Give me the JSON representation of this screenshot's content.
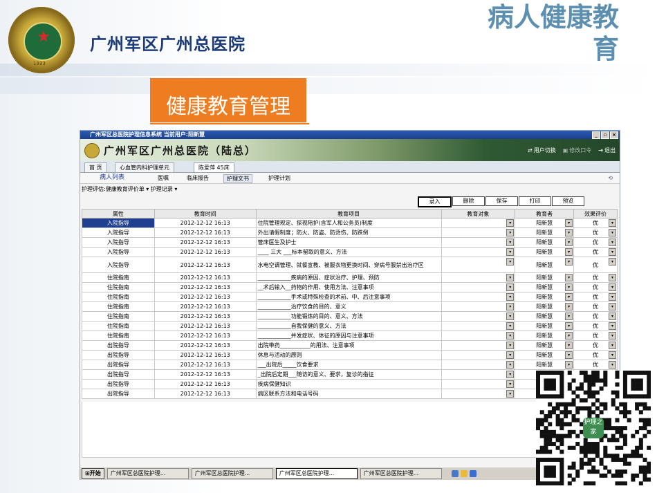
{
  "slide": {
    "hospital_name": "广州军区广州总医院",
    "title": "病人健康教育",
    "section": "健康教育管理",
    "logo_year": "1933",
    "logo_text": "General Hospital of Guangzhou Military Command"
  },
  "window": {
    "title": "广州军区总医院护理信息系统  当前用户:阳新慧",
    "banner_title": "广州军区广州总医院（陆总）",
    "actions": [
      "用户切换",
      "修改口令",
      "退出"
    ],
    "tabs": [
      "首  页",
      "心血管内科护理单元",
      "陈爱萍 45床"
    ],
    "subtabs": [
      "病人列表",
      "医嘱",
      "临床报告",
      "护理文书",
      "护理计划"
    ],
    "breadcrumb": "护理评估:健康教育评价单 ▾  护理记录 ▾",
    "toolbar": [
      "录入",
      "删除",
      "保存",
      "打印",
      "预览"
    ],
    "columns": [
      "属性",
      "教育时间",
      "教育项目",
      "教育对象",
      "教育者",
      "效果评价"
    ],
    "rows": [
      {
        "attr": "入院指导",
        "time": "2012-12-12 16:13",
        "item": "住院管理规定、探视陪护(含军人和公务员)制度",
        "target": "",
        "educator": "阳新慧",
        "eval": "优"
      },
      {
        "attr": "入院指导",
        "time": "2012-12-12 16:13",
        "item": "外出请假制度；防火、防盗、防烫伤、防跌倒",
        "target": "",
        "educator": "阳新慧",
        "eval": "优"
      },
      {
        "attr": "入院指导",
        "time": "2012-12-12 16:13",
        "item": "管床医生及护士",
        "target": "",
        "educator": "阳新慧",
        "eval": "优"
      },
      {
        "attr": "入院指导",
        "time": "2012-12-12 16:13",
        "item": "____ 三大 ___标本留取的意义、方法",
        "target": "",
        "educator": "阳新慧",
        "eval": "优"
      },
      {
        "attr": "入院指导",
        "time": "2012-12-12 16:13",
        "item": "水电空调管理、就餐宣教、被服衣物更换时间、穿病号服禁出治疗区",
        "target": "",
        "educator": "阳新慧",
        "eval": "优"
      },
      {
        "attr": "住院指南",
        "time": "2012-12-12 16:13",
        "item": "____________疾病的原因、症状治疗、护理、预防",
        "target": "",
        "educator": "阳新慧",
        "eval": "优"
      },
      {
        "attr": "住院指南",
        "time": "2012-12-12 16:13",
        "item": "__术后输入__药物的作用、使用方法、注意事项",
        "target": "",
        "educator": "阳新慧",
        "eval": "优"
      },
      {
        "attr": "住院指南",
        "time": "2012-12-12 16:13",
        "item": "____________手术或特殊检查的术前、中、后注意事项",
        "target": "",
        "educator": "阳新慧",
        "eval": "优"
      },
      {
        "attr": "住院指南",
        "time": "2012-12-12 16:13",
        "item": "____________治疗饮食的目的、意义",
        "target": "",
        "educator": "阳新慧",
        "eval": "优"
      },
      {
        "attr": "住院指南",
        "time": "2012-12-12 16:13",
        "item": "____________功能锻炼的目的、意义、方法",
        "target": "",
        "educator": "阳新慧",
        "eval": "优"
      },
      {
        "attr": "住院指南",
        "time": "2012-12-12 16:13",
        "item": "____________自我保健的意义、方法",
        "target": "",
        "educator": "阳新慧",
        "eval": "优"
      },
      {
        "attr": "住院指南",
        "time": "2012-12-12 16:13",
        "item": "____________并发症状、体征的原因与注意事项",
        "target": "",
        "educator": "阳新慧",
        "eval": "优"
      },
      {
        "attr": "出院指导",
        "time": "2012-12-12 16:13",
        "item": "出院带药___________的用法、注意事项",
        "target": "",
        "educator": "阳新慧",
        "eval": "优"
      },
      {
        "attr": "出院指导",
        "time": "2012-12-12 16:13",
        "item": "休息与活动的原则",
        "target": "",
        "educator": "阳新慧",
        "eval": "优"
      },
      {
        "attr": "出院指导",
        "time": "2012-12-12 16:13",
        "item": "___出院后_____饮食要求",
        "target": "",
        "educator": "阳新慧",
        "eval": "优"
      },
      {
        "attr": "出院指导",
        "time": "2012-12-12 16:13",
        "item": "_出院后定期___随访的意义、要求，复诊的指征",
        "target": "",
        "educator": "",
        "eval": ""
      },
      {
        "attr": "出院指导",
        "time": "2012-12-12 16:13",
        "item": "疾病保健知识",
        "target": "",
        "educator": "",
        "eval": ""
      },
      {
        "attr": "出院指导",
        "time": "2012-12-12 16:13",
        "item": "病区联系方法和电话号码",
        "target": "",
        "educator": "",
        "eval": ""
      }
    ],
    "taskbar": {
      "start": "开始",
      "tasks": [
        "广州军区总医院护理...",
        "广州军区总医院护理...",
        "广州军区总医院护理...",
        "广州军区总医院护理..."
      ]
    }
  },
  "qr": {
    "label": "护理之家"
  },
  "colors": {
    "orange": "#ee7d22",
    "title_blue": "#5d8fb0",
    "hosp_blue": "#1a3a78",
    "selection": "#1f3f8f"
  }
}
